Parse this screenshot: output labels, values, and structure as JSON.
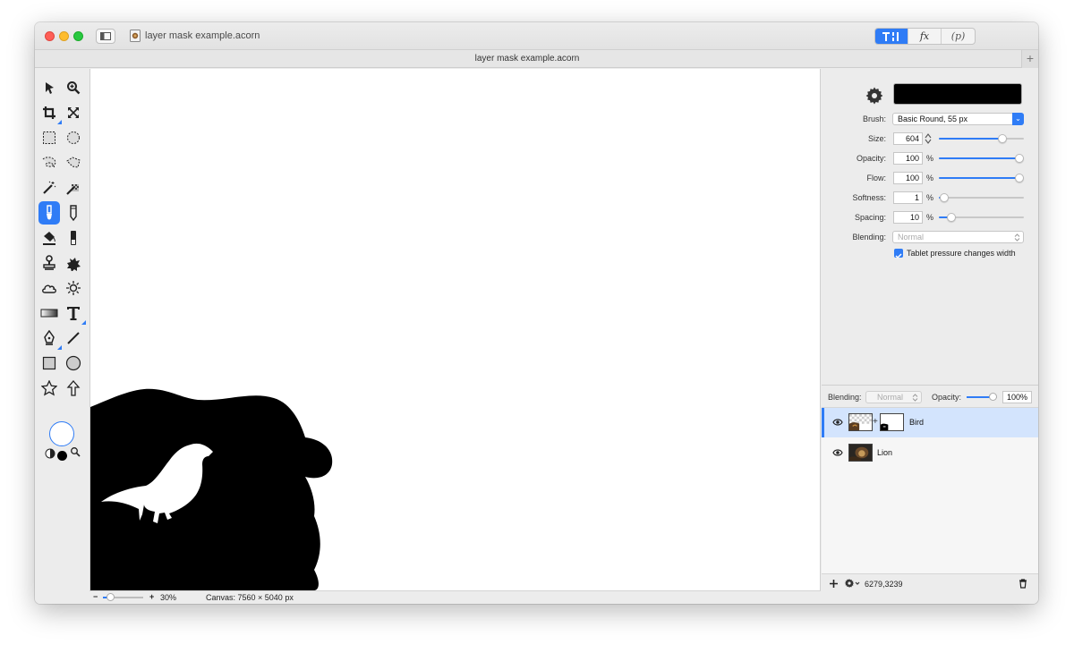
{
  "window": {
    "title": "layer mask example.acorn",
    "tab_title": "layer mask example.acorn",
    "tab_add": "+"
  },
  "toolbar_segments": [
    {
      "name": "tools-inspector",
      "label": "T⁝",
      "active": true
    },
    {
      "name": "filters",
      "label": "fx",
      "active": false
    },
    {
      "name": "plugins",
      "label": "(p)",
      "active": false
    }
  ],
  "tools": {
    "selected": "brush-tool",
    "stroke_color": "#000000",
    "fill_color": "#ffffff"
  },
  "status": {
    "zoom_minus": "−",
    "zoom_plus": "+",
    "zoom_level": "30%",
    "zoom_slider": 0.1,
    "canvas_info": "Canvas: 7560 × 5040 px"
  },
  "inspector": {
    "brush_color": "#000000",
    "brush_label": "Brush:",
    "brush_value": "Basic Round, 55 px",
    "size_label": "Size:",
    "size_value": "604",
    "size_slider": 0.78,
    "opacity_label": "Opacity:",
    "opacity_value": "100",
    "opacity_slider": 1.0,
    "flow_label": "Flow:",
    "flow_value": "100",
    "flow_slider": 1.0,
    "softness_label": "Softness:",
    "softness_value": "1",
    "softness_slider": 0.01,
    "spacing_label": "Spacing:",
    "spacing_value": "10",
    "spacing_slider": 0.1,
    "percent": "%",
    "blending_label": "Blending:",
    "blending_value": "Normal",
    "tablet_label": "Tablet pressure changes width",
    "tablet_checked": true
  },
  "layers": {
    "blending_label": "Blending:",
    "blending_value": "Normal",
    "opacity_label": "Opacity:",
    "opacity_value": "100%",
    "opacity_slider": 1.0,
    "items": [
      {
        "name": "Bird",
        "selected": true,
        "has_mask": true,
        "mask_link": "+"
      },
      {
        "name": "Lion",
        "selected": false,
        "has_mask": false
      }
    ],
    "cursor_coords": "6279,3239"
  }
}
